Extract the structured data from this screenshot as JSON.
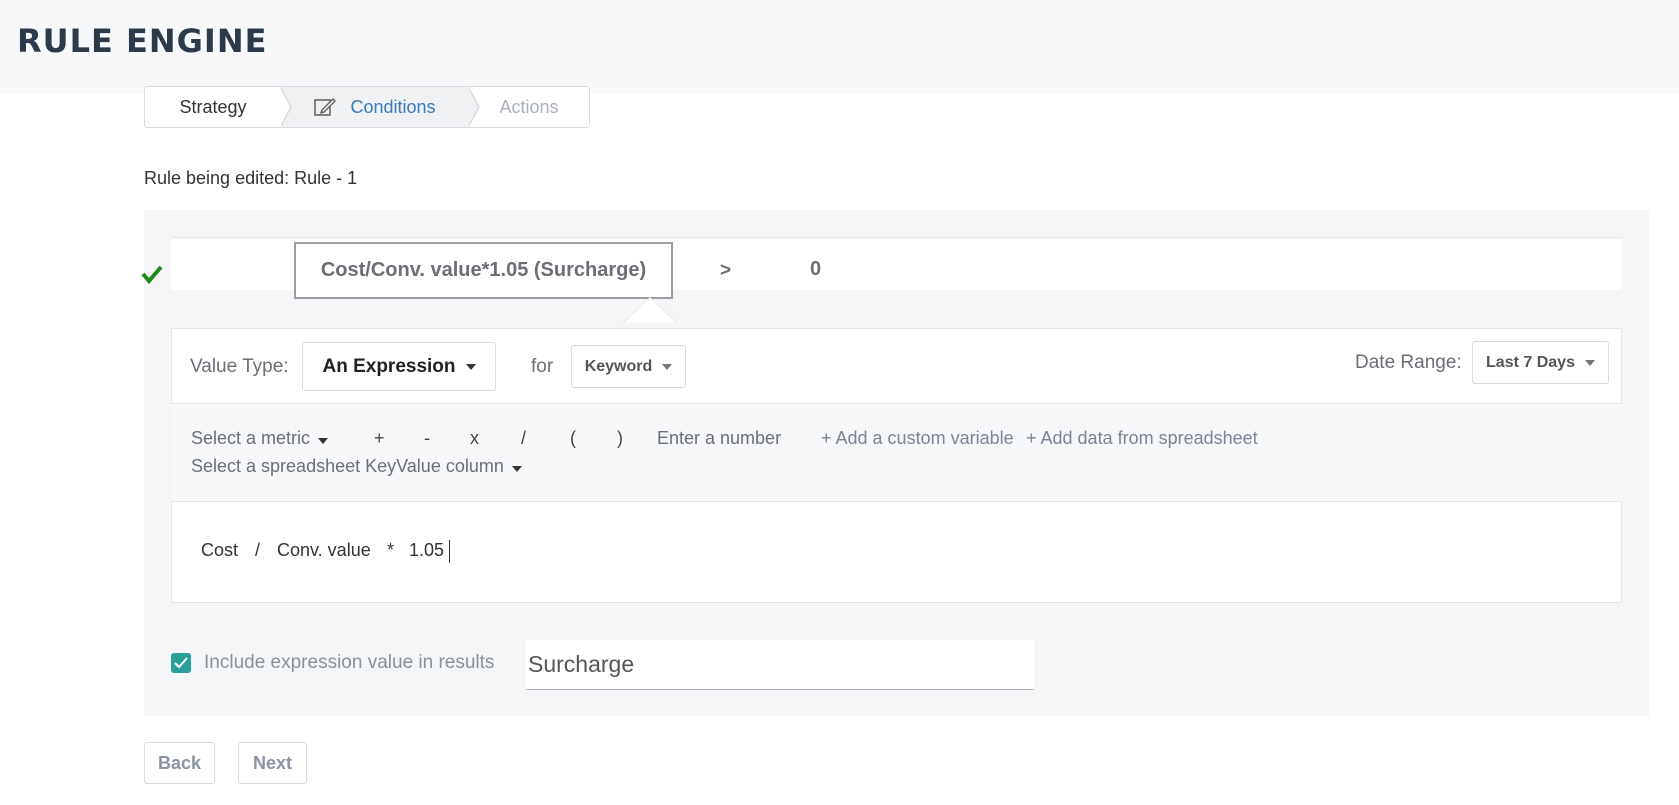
{
  "header": {
    "title": "RULE ENGINE"
  },
  "steps": [
    {
      "label": "Strategy"
    },
    {
      "label": "Conditions"
    },
    {
      "label": "Actions"
    }
  ],
  "rule_label": "Rule being edited: Rule - 1",
  "condition": {
    "expression": "Cost/Conv. value*1.05 (Surcharge)",
    "operator": ">",
    "value": "0"
  },
  "value_type": {
    "label": "Value Type:",
    "selected": "An Expression"
  },
  "for": {
    "label": "for",
    "selected": "Keyword"
  },
  "date_range": {
    "label": "Date Range:",
    "selected": "Last 7 Days"
  },
  "toolbar": {
    "select_metric": "Select a metric",
    "ops": [
      "+",
      "-",
      "x",
      "/",
      "(",
      ")"
    ],
    "enter_number": "Enter a number",
    "add_custom_variable": "+ Add a custom variable",
    "add_spreadsheet_data": "+ Add data from spreadsheet",
    "select_keyvalue": "Select a spreadsheet KeyValue column"
  },
  "expression_tokens": [
    "Cost",
    "/",
    "Conv. value",
    "*",
    "1.05"
  ],
  "include": {
    "label": "Include expression value in results",
    "checked": true,
    "name_value": "Surcharge"
  },
  "buttons": {
    "back": "Back",
    "next": "Next"
  },
  "colors": {
    "accent": "#3a7abf",
    "check": "#1f8a1f",
    "checkbox": "#2aa198"
  }
}
